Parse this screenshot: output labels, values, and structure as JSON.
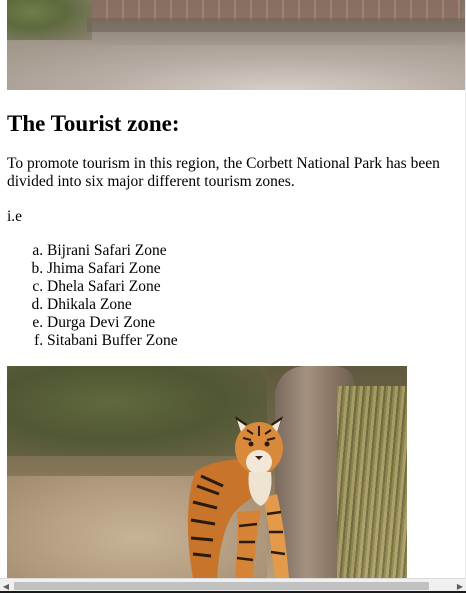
{
  "article": {
    "heading": "The Tourist zone:",
    "intro": "To promote tourism in this region, the Corbett National Park has been divided into six major different tourism zones.",
    "ie": "i.e",
    "zones": [
      "Bijrani Safari Zone",
      "Jhima Safari Zone",
      "Dhela Safari Zone",
      "Dhikala Zone",
      "Durga Devi Zone",
      "Sitabani Buffer Zone"
    ]
  },
  "scrollbar": {
    "left_arrow_icon": "chevron-left-icon",
    "right_arrow_icon": "chevron-right-icon",
    "left_arrow_glyph": "◀",
    "right_arrow_glyph": "▶"
  },
  "colors": {
    "text": "#000000",
    "background": "#ffffff",
    "scrollbar_track": "#f0f0f0",
    "scrollbar_thumb": "#c1c1c1"
  }
}
